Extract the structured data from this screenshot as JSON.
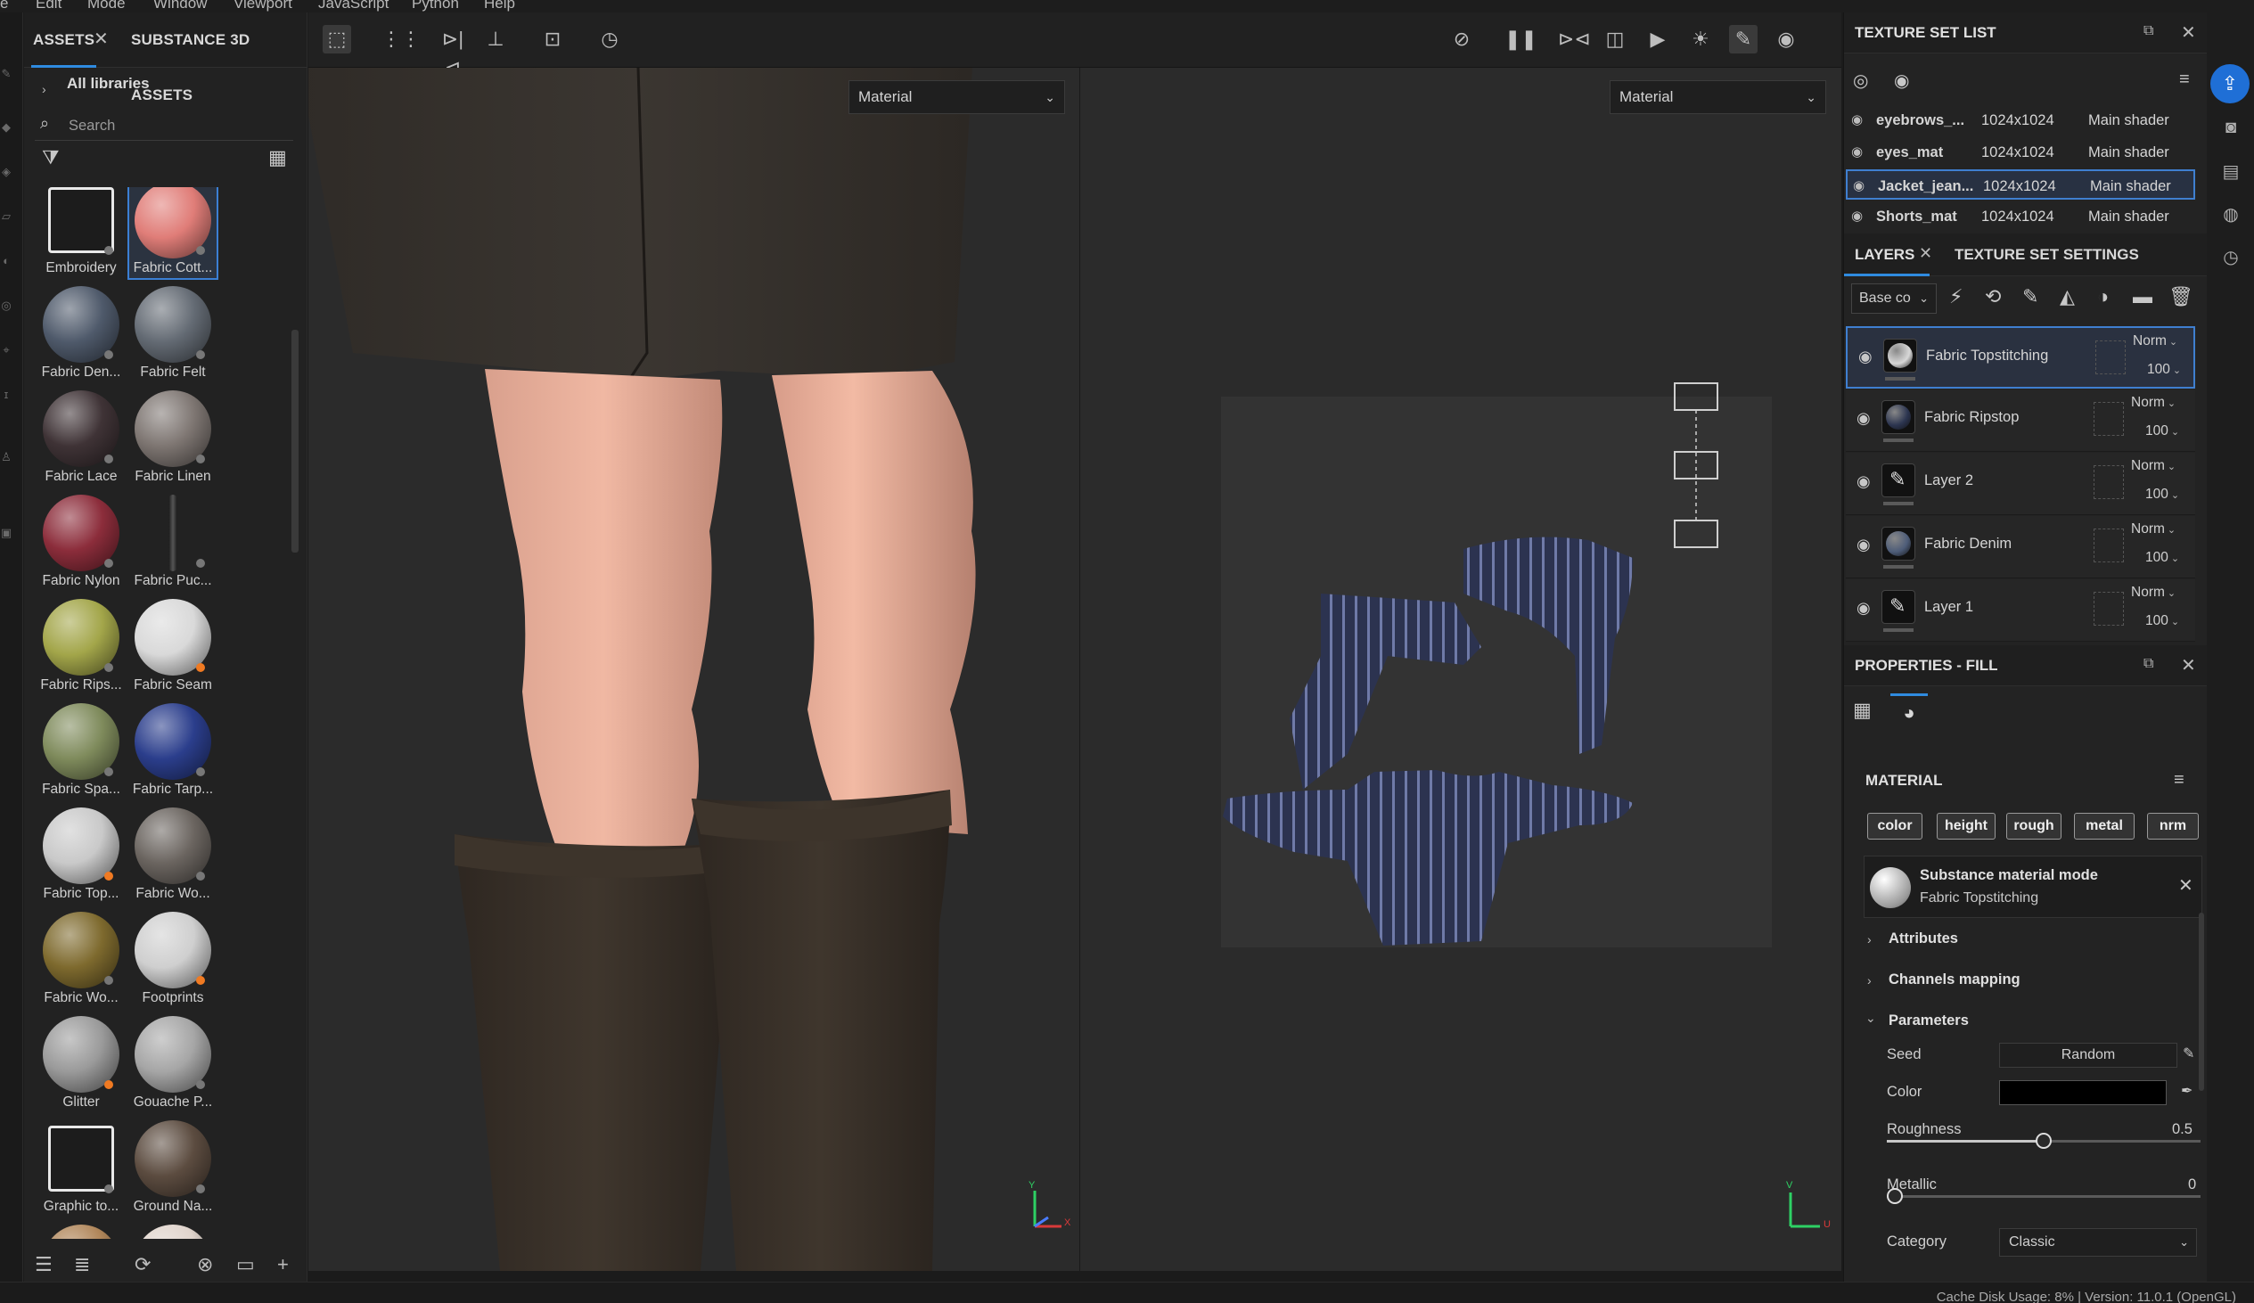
{
  "menubar": {
    "items": [
      "e",
      "Edit",
      "Mode",
      "Window",
      "Viewport",
      "JavaScript",
      "Python",
      "Help"
    ]
  },
  "assets_panel": {
    "tab_assets": "ASSETS",
    "tab_substance": "SUBSTANCE 3D ASSETS",
    "all_libraries": "All libraries",
    "search_placeholder": "Search",
    "items": [
      {
        "label": "Embroidery",
        "color": "#e8e8e8",
        "icon": true
      },
      {
        "label": "Fabric Cott...",
        "color": "#e07d78",
        "selected": true
      },
      {
        "label": "Fabric Den...",
        "color": "#4f5a6b"
      },
      {
        "label": "Fabric Felt",
        "color": "#646b74"
      },
      {
        "label": "Fabric Lace",
        "color": "#3f3336"
      },
      {
        "label": "Fabric Linen",
        "color": "#7e7672"
      },
      {
        "label": "Fabric Nylon",
        "color": "#8c2d3b"
      },
      {
        "label": "Fabric Puc...",
        "color": "#2a2a2a",
        "thin": true
      },
      {
        "label": "Fabric Rips...",
        "color": "#a3a64a"
      },
      {
        "label": "Fabric Seam",
        "color": "#d9d9d9"
      },
      {
        "label": "Fabric Spa...",
        "color": "#7f8b5c"
      },
      {
        "label": "Fabric Tarp...",
        "color": "#2b3e8c"
      },
      {
        "label": "Fabric Top...",
        "color": "#c9c9c9"
      },
      {
        "label": "Fabric Wo...",
        "color": "#6b6560"
      },
      {
        "label": "Fabric Wo...",
        "color": "#7e6a2e"
      },
      {
        "label": "Footprints",
        "color": "#cfcfcf"
      },
      {
        "label": "Glitter",
        "color": "#9a9a9a"
      },
      {
        "label": "Gouache P...",
        "color": "#a6a6a6"
      },
      {
        "label": "Graphic to...",
        "color": "#e8e8e8",
        "icon": true
      },
      {
        "label": "Ground Na...",
        "color": "#5c4c40"
      },
      {
        "label": "",
        "color": "#b0865a"
      },
      {
        "label": "",
        "color": "#e0d4cc"
      }
    ]
  },
  "viewport": {
    "left_dropdown": "Material",
    "right_dropdown": "Material",
    "axis_y": "Y",
    "axis_x": "X",
    "axis_v": "V",
    "axis_u": "U"
  },
  "texture_set_list": {
    "title": "TEXTURE SET LIST",
    "rows": [
      {
        "name": "eyebrows_...",
        "res": "1024x1024",
        "shader": "Main shader"
      },
      {
        "name": "eyes_mat",
        "res": "1024x1024",
        "shader": "Main shader"
      },
      {
        "name": "Jacket_jean...",
        "res": "1024x1024",
        "shader": "Main shader",
        "selected": true
      },
      {
        "name": "Shorts_mat",
        "res": "1024x1024",
        "shader": "Main shader"
      }
    ]
  },
  "layers": {
    "tab_layers": "LAYERS",
    "tab_tss": "TEXTURE SET SETTINGS",
    "channel_select": "Base co",
    "rows": [
      {
        "name": "Fabric Topstitching",
        "blend": "Norm",
        "opacity": "100",
        "thumb_color": "#d8d8d8",
        "selected": true
      },
      {
        "name": "Fabric Ripstop",
        "blend": "Norm",
        "opacity": "100",
        "thumb_color": "#2c3550"
      },
      {
        "name": "Layer 2",
        "blend": "Norm",
        "opacity": "100",
        "paint": true
      },
      {
        "name": "Fabric Denim",
        "blend": "Norm",
        "opacity": "100",
        "thumb_color": "#4d5c78"
      },
      {
        "name": "Layer 1",
        "blend": "Norm",
        "opacity": "100",
        "paint": true
      }
    ]
  },
  "properties": {
    "title": "PROPERTIES - FILL",
    "material_label": "MATERIAL",
    "channels": [
      "color",
      "height",
      "rough",
      "metal",
      "nrm"
    ],
    "mode_title": "Substance material mode",
    "mode_material": "Fabric Topstitching",
    "sections": {
      "attributes": "Attributes",
      "channels_mapping": "Channels mapping",
      "parameters": "Parameters"
    },
    "seed_label": "Seed",
    "seed_value": "Random",
    "color_label": "Color",
    "color_value": "#000000",
    "roughness_label": "Roughness",
    "roughness_value": "0.5",
    "metallic_label": "Metallic",
    "metallic_value": "0",
    "category_label": "Category",
    "category_value": "Classic"
  },
  "statusbar": {
    "text": "Cache Disk Usage:   8% | Version: 11.0.1 (OpenGL)"
  },
  "colors": {
    "accent": "#2f8be0",
    "selection": "#3f7fd0",
    "panel_bg": "#232323"
  }
}
